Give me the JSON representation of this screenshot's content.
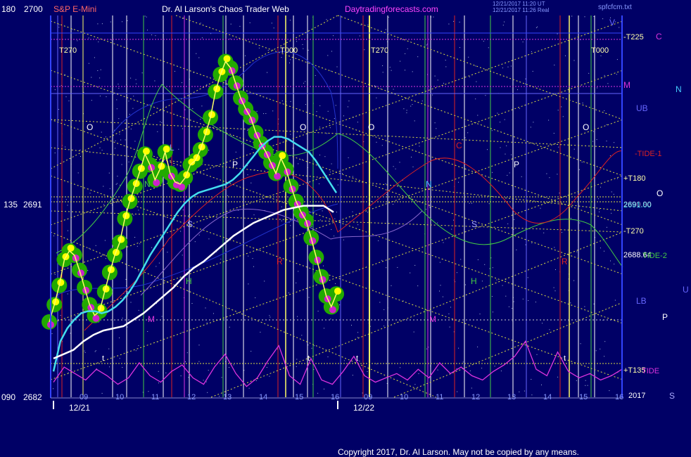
{
  "header": {
    "left_axis_top": "180",
    "price_top": "2700",
    "symbol": "S&P E-Mini",
    "brand": "Dr. Al Larson's Chaos Trader Web",
    "site": "Daytradingforecasts.com",
    "stamp_line1": "12/21/2017 11:20 UT",
    "stamp_line2": "12/21/2017 11:26 Real",
    "file": "spfcfcm.txt"
  },
  "left_axis": {
    "mid_angle": "135",
    "mid_price": "2691",
    "bottom_angle": "090",
    "bottom_price": "2682"
  },
  "x_axis": {
    "hour_ticks": [
      "09",
      "10",
      "11",
      "12",
      "13",
      "14",
      "15",
      "16",
      "09",
      "10",
      "11",
      "12",
      "13",
      "14",
      "15",
      "16"
    ],
    "dates": [
      "12/21",
      "12/22"
    ]
  },
  "grid_labels": {
    "t270_left": "T270",
    "t000_left": "T000",
    "t270_right": "T270",
    "t000_right": "T000",
    "o": "O",
    "n": "N",
    "p": "P",
    "s": "S",
    "h": "H",
    "m": "M",
    "r": "R",
    "c": "C",
    "t": "t",
    "l": "L"
  },
  "right_labels": {
    "t225": "-T225",
    "c_right": "C",
    "v": "V",
    "m_right": "M",
    "n_right": "N",
    "ub": "UB",
    "tide1": "-TIDE-1",
    "t180": "+T180",
    "o_right": "O",
    "price_a": "2691.00",
    "price_b": "2690.90",
    "t270m": "-T270",
    "price_c": "2688.64",
    "tide2": "TIDE-2",
    "u": "U",
    "lb": "LB",
    "p_right": "P",
    "t135": "+T135",
    "tide": "TIDE",
    "year": "2017",
    "s_right": "S"
  },
  "footer": {
    "copyright": "Copyright 2017, Dr. Al Larson. May not be copied by any means."
  },
  "colors": {
    "background": "#000066",
    "price_line": "#ffff66",
    "glow_green": "#22aa00",
    "dot_yellow": "#ffff00",
    "dot_magenta": "#cc22cc",
    "cyan_ma": "#44ddee",
    "white_ma": "#ffffff",
    "tide": "#dd33dd",
    "grid": "#dddd44"
  },
  "chart_data": {
    "type": "line",
    "y_range": [
      2682,
      2700
    ],
    "series": [
      {
        "values": [
          2685.5,
          2686.3,
          2687.2,
          2688.4,
          2688.8,
          2688.6,
          2687.9,
          2687.1,
          2686.3,
          2685.8,
          2686.0,
          2686.9,
          2687.8,
          2688.6,
          2689.2,
          2690.3,
          2691.1,
          2691.8,
          2692.5,
          2693.3,
          2692.8,
          2692.1,
          2692.6,
          2693.4,
          2692.4,
          2692.0,
          2691.9,
          2692.2,
          2692.8,
          2693.0,
          2693.5,
          2694.2,
          2695.0,
          2696.2,
          2697.0,
          2697.6,
          2697.3,
          2696.6,
          2695.9,
          2695.4,
          2695.0,
          2694.3,
          2693.8,
          2693.4,
          2692.9,
          2692.4,
          2693.1,
          2692.6,
          2691.8,
          2691.1,
          2690.6,
          2690.2,
          2689.4,
          2688.5,
          2687.6,
          2686.7,
          2686.2,
          2686.8
        ]
      },
      {
        "values": [
          2683.2,
          2684.6,
          2685.2,
          2685.6,
          2685.9,
          2686.0,
          2686.0,
          2685.9,
          2686.0,
          2686.2,
          2686.5,
          2686.9,
          2687.4,
          2688.0,
          2688.6,
          2689.1,
          2689.6,
          2690.1,
          2690.6,
          2691.0,
          2691.3,
          2691.5,
          2691.6,
          2691.7,
          2691.8,
          2691.9,
          2692.1,
          2692.4,
          2692.8,
          2693.2,
          2693.6,
          2693.9,
          2694.1,
          2694.1,
          2694.0,
          2693.8,
          2693.6,
          2693.4,
          2693.0,
          2692.5,
          2692.0,
          2691.5
        ]
      },
      {
        "values": [
          2683.8,
          2684.0,
          2684.2,
          2684.6,
          2684.9,
          2685.1,
          2685.2,
          2685.3,
          2685.6,
          2685.9,
          2686.3,
          2686.7,
          2687.1,
          2687.6,
          2688.0,
          2688.3,
          2688.7,
          2689.1,
          2689.5,
          2689.8,
          2690.1,
          2690.3,
          2690.5,
          2690.7,
          2690.8,
          2690.9,
          2690.9,
          2690.9,
          2690.6
        ]
      },
      {
        "values": [
          2682.7,
          2683.4,
          2683.1,
          2682.8,
          2683.3,
          2683.0,
          2682.6,
          2682.9,
          2683.6,
          2683.0,
          2682.7,
          2683.2,
          2683.5,
          2682.9,
          2682.6,
          2683.4,
          2684.0,
          2683.1,
          2682.5,
          2682.9,
          2683.7,
          2684.4,
          2683.0,
          2682.6,
          2683.8,
          2682.8,
          2682.6,
          2683.2,
          2683.9,
          2683.0,
          2682.7,
          2682.9,
          2683.1,
          2682.8,
          2683.3,
          2682.9,
          2683.6,
          2683.1,
          2683.4,
          2683.0,
          2682.8,
          2683.2,
          2683.5,
          2683.9,
          2684.6,
          2683.3,
          2683.0,
          2684.1,
          2683.2,
          2682.9,
          2683.1,
          2682.8,
          2683.0,
          2683.3
        ]
      }
    ]
  }
}
